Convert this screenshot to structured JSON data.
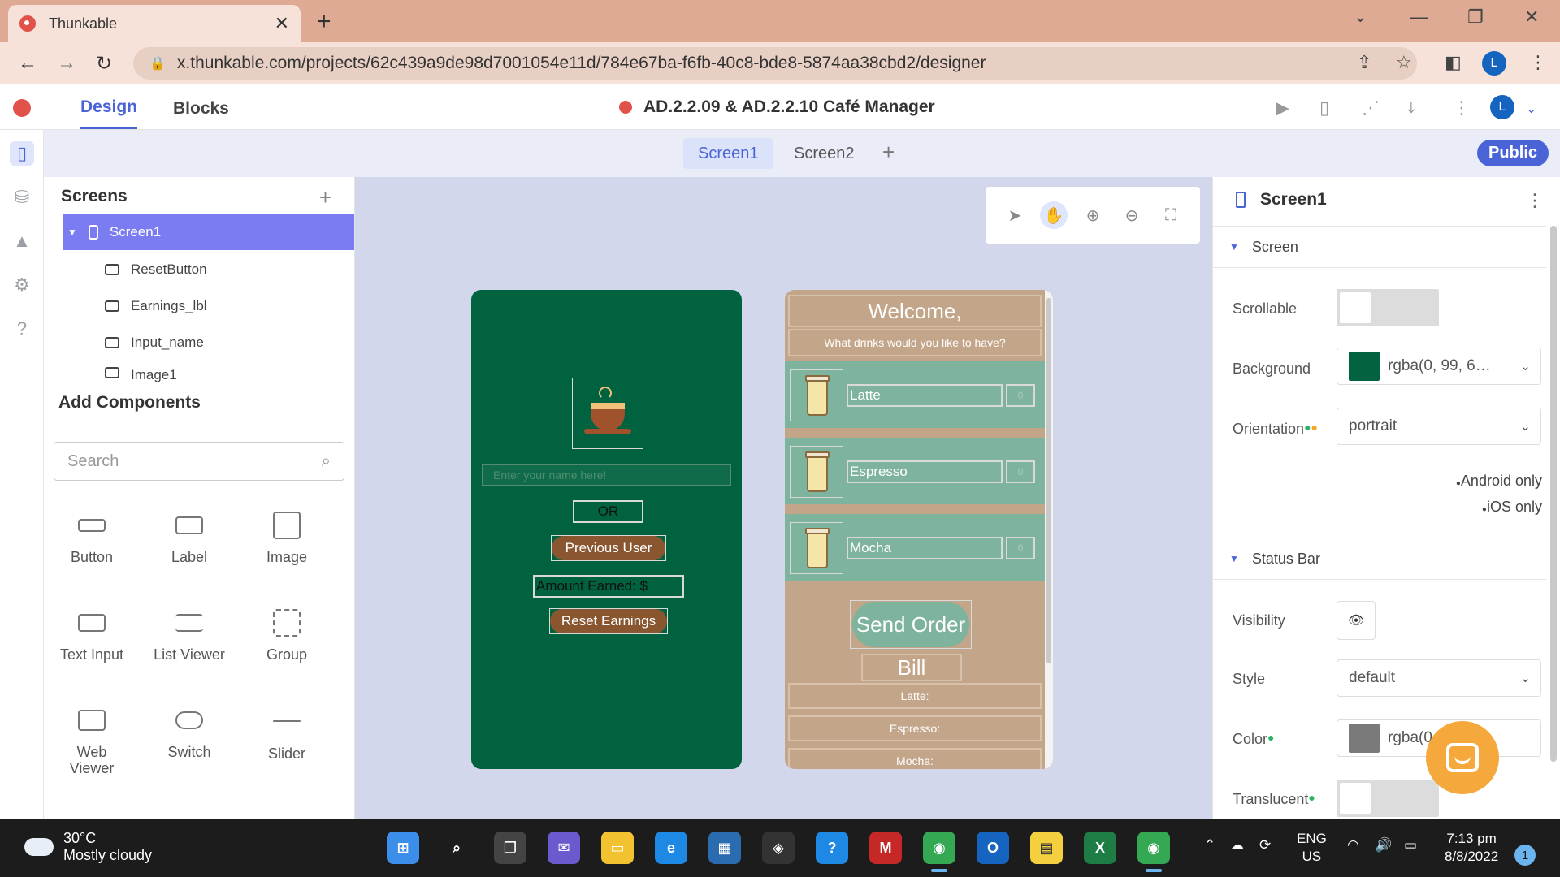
{
  "browser": {
    "tab_title": "Thunkable",
    "tab_close": "✕",
    "new_tab": "+",
    "url": "x.thunkable.com/projects/62c439a9de98d7001054e11d/784e67ba-f6fb-40c8-bde8-5874aa38cbd2/designer",
    "profile_initial": "L",
    "window_minimize": "—",
    "window_restore": "❐",
    "window_close": "✕",
    "back": "←",
    "forward": "→",
    "reload": "↻"
  },
  "app": {
    "tab_design": "Design",
    "tab_blocks": "Blocks",
    "project_title": "AD.2.2.09 & AD.2.2.10 Café Manager",
    "profile_initial": "L",
    "screen_tabs": [
      "Screen1",
      "Screen2"
    ],
    "add_screen": "+",
    "public_button": "Public"
  },
  "left_panel": {
    "screens_heading": "Screens",
    "add_screen": "+",
    "tree": [
      {
        "label": "Screen1",
        "selected": true
      },
      {
        "label": "ResetButton"
      },
      {
        "label": "Earnings_lbl"
      },
      {
        "label": "Input_name"
      },
      {
        "label": "Image1"
      }
    ],
    "add_components_heading": "Add Components",
    "search_placeholder": "Search",
    "components": [
      "Button",
      "Label",
      "Image",
      "Text Input",
      "List Viewer",
      "Group",
      "Web Viewer",
      "Switch",
      "Slider"
    ]
  },
  "phone1": {
    "background": "#00623f",
    "name_placeholder": "Enter your name here!",
    "or_label": "OR",
    "previous_user": "Previous User",
    "amount_earned": "Amount Earned: $",
    "reset_earnings": "Reset Earnings"
  },
  "phone2": {
    "welcome": "Welcome,",
    "prompt": "What drinks would you like to have?",
    "drinks": [
      {
        "name": "Latte",
        "qty": "0"
      },
      {
        "name": "Espresso",
        "qty": "0"
      },
      {
        "name": "Mocha",
        "qty": "0"
      }
    ],
    "send_order": "Send Order",
    "bill": "Bill",
    "bill_lines": [
      "Latte:",
      "Espresso:",
      "Mocha:"
    ]
  },
  "right_panel": {
    "title": "Screen1",
    "section_screen": "Screen",
    "scrollable_label": "Scrollable",
    "background_label": "Background",
    "background_value": "rgba(0, 99, 6…",
    "background_color": "#00623f",
    "orientation_label": "Orientation",
    "orientation_value": "portrait",
    "android_only": "Android only",
    "ios_only": "iOS only",
    "section_status_bar": "Status Bar",
    "visibility_label": "Visibility",
    "style_label": "Style",
    "style_value": "default",
    "color_label": "Color",
    "color_value": "rgba(0,0,0,0",
    "color_swatch": "#7a7a7a",
    "translucent_label": "Translucent"
  },
  "taskbar": {
    "temperature": "30°C",
    "weather": "Mostly cloudy",
    "lang_1": "ENG",
    "lang_2": "US",
    "time": "7:13 pm",
    "date": "8/8/2022",
    "notifications": "1"
  }
}
